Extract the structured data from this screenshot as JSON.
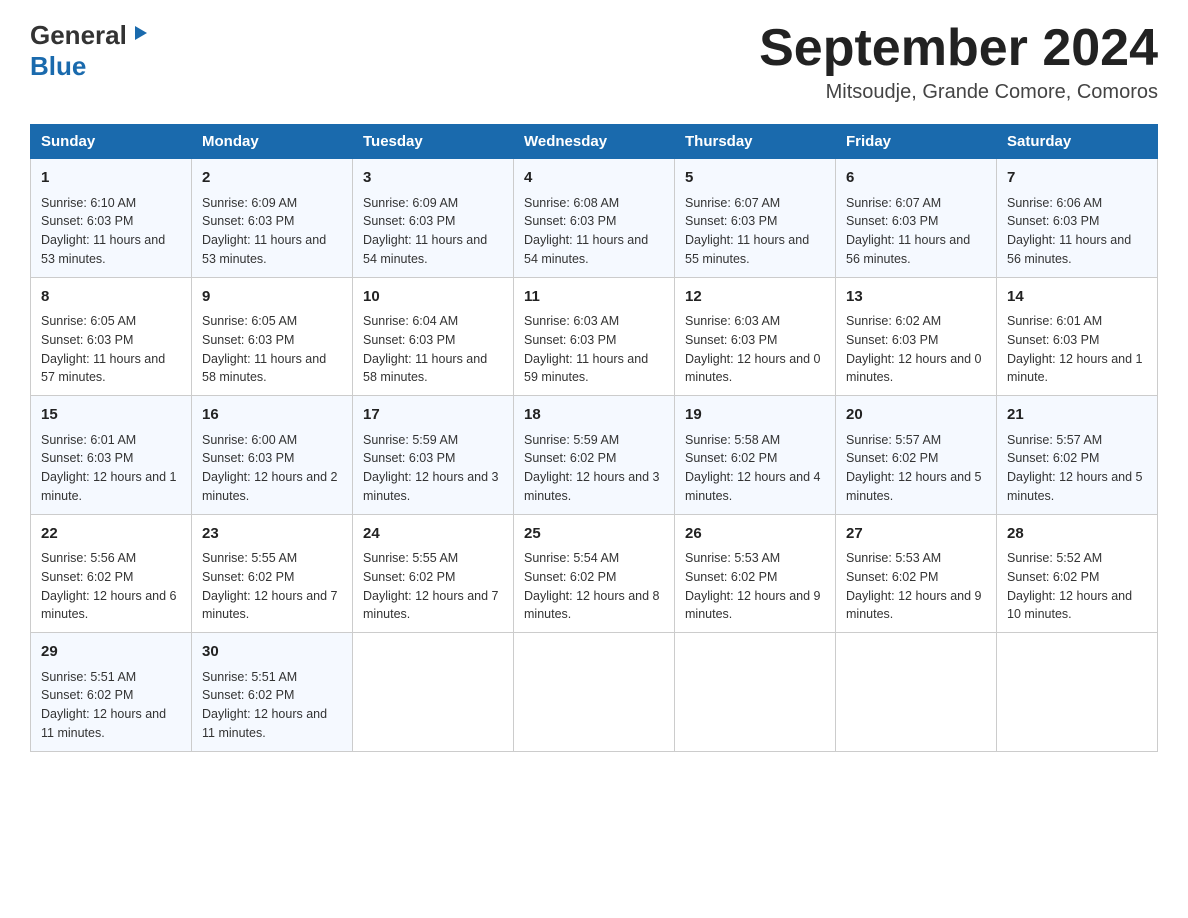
{
  "header": {
    "logo_general": "General",
    "logo_blue": "Blue",
    "month_title": "September 2024",
    "location": "Mitsoudje, Grande Comore, Comoros"
  },
  "days_of_week": [
    "Sunday",
    "Monday",
    "Tuesday",
    "Wednesday",
    "Thursday",
    "Friday",
    "Saturday"
  ],
  "weeks": [
    {
      "days": [
        {
          "num": "1",
          "sunrise": "6:10 AM",
          "sunset": "6:03 PM",
          "daylight": "11 hours and 53 minutes."
        },
        {
          "num": "2",
          "sunrise": "6:09 AM",
          "sunset": "6:03 PM",
          "daylight": "11 hours and 53 minutes."
        },
        {
          "num": "3",
          "sunrise": "6:09 AM",
          "sunset": "6:03 PM",
          "daylight": "11 hours and 54 minutes."
        },
        {
          "num": "4",
          "sunrise": "6:08 AM",
          "sunset": "6:03 PM",
          "daylight": "11 hours and 54 minutes."
        },
        {
          "num": "5",
          "sunrise": "6:07 AM",
          "sunset": "6:03 PM",
          "daylight": "11 hours and 55 minutes."
        },
        {
          "num": "6",
          "sunrise": "6:07 AM",
          "sunset": "6:03 PM",
          "daylight": "11 hours and 56 minutes."
        },
        {
          "num": "7",
          "sunrise": "6:06 AM",
          "sunset": "6:03 PM",
          "daylight": "11 hours and 56 minutes."
        }
      ]
    },
    {
      "days": [
        {
          "num": "8",
          "sunrise": "6:05 AM",
          "sunset": "6:03 PM",
          "daylight": "11 hours and 57 minutes."
        },
        {
          "num": "9",
          "sunrise": "6:05 AM",
          "sunset": "6:03 PM",
          "daylight": "11 hours and 58 minutes."
        },
        {
          "num": "10",
          "sunrise": "6:04 AM",
          "sunset": "6:03 PM",
          "daylight": "11 hours and 58 minutes."
        },
        {
          "num": "11",
          "sunrise": "6:03 AM",
          "sunset": "6:03 PM",
          "daylight": "11 hours and 59 minutes."
        },
        {
          "num": "12",
          "sunrise": "6:03 AM",
          "sunset": "6:03 PM",
          "daylight": "12 hours and 0 minutes."
        },
        {
          "num": "13",
          "sunrise": "6:02 AM",
          "sunset": "6:03 PM",
          "daylight": "12 hours and 0 minutes."
        },
        {
          "num": "14",
          "sunrise": "6:01 AM",
          "sunset": "6:03 PM",
          "daylight": "12 hours and 1 minute."
        }
      ]
    },
    {
      "days": [
        {
          "num": "15",
          "sunrise": "6:01 AM",
          "sunset": "6:03 PM",
          "daylight": "12 hours and 1 minute."
        },
        {
          "num": "16",
          "sunrise": "6:00 AM",
          "sunset": "6:03 PM",
          "daylight": "12 hours and 2 minutes."
        },
        {
          "num": "17",
          "sunrise": "5:59 AM",
          "sunset": "6:03 PM",
          "daylight": "12 hours and 3 minutes."
        },
        {
          "num": "18",
          "sunrise": "5:59 AM",
          "sunset": "6:02 PM",
          "daylight": "12 hours and 3 minutes."
        },
        {
          "num": "19",
          "sunrise": "5:58 AM",
          "sunset": "6:02 PM",
          "daylight": "12 hours and 4 minutes."
        },
        {
          "num": "20",
          "sunrise": "5:57 AM",
          "sunset": "6:02 PM",
          "daylight": "12 hours and 5 minutes."
        },
        {
          "num": "21",
          "sunrise": "5:57 AM",
          "sunset": "6:02 PM",
          "daylight": "12 hours and 5 minutes."
        }
      ]
    },
    {
      "days": [
        {
          "num": "22",
          "sunrise": "5:56 AM",
          "sunset": "6:02 PM",
          "daylight": "12 hours and 6 minutes."
        },
        {
          "num": "23",
          "sunrise": "5:55 AM",
          "sunset": "6:02 PM",
          "daylight": "12 hours and 7 minutes."
        },
        {
          "num": "24",
          "sunrise": "5:55 AM",
          "sunset": "6:02 PM",
          "daylight": "12 hours and 7 minutes."
        },
        {
          "num": "25",
          "sunrise": "5:54 AM",
          "sunset": "6:02 PM",
          "daylight": "12 hours and 8 minutes."
        },
        {
          "num": "26",
          "sunrise": "5:53 AM",
          "sunset": "6:02 PM",
          "daylight": "12 hours and 9 minutes."
        },
        {
          "num": "27",
          "sunrise": "5:53 AM",
          "sunset": "6:02 PM",
          "daylight": "12 hours and 9 minutes."
        },
        {
          "num": "28",
          "sunrise": "5:52 AM",
          "sunset": "6:02 PM",
          "daylight": "12 hours and 10 minutes."
        }
      ]
    },
    {
      "days": [
        {
          "num": "29",
          "sunrise": "5:51 AM",
          "sunset": "6:02 PM",
          "daylight": "12 hours and 11 minutes."
        },
        {
          "num": "30",
          "sunrise": "5:51 AM",
          "sunset": "6:02 PM",
          "daylight": "12 hours and 11 minutes."
        },
        null,
        null,
        null,
        null,
        null
      ]
    }
  ],
  "labels": {
    "sunrise_prefix": "Sunrise: ",
    "sunset_prefix": "Sunset: ",
    "daylight_prefix": "Daylight: "
  }
}
